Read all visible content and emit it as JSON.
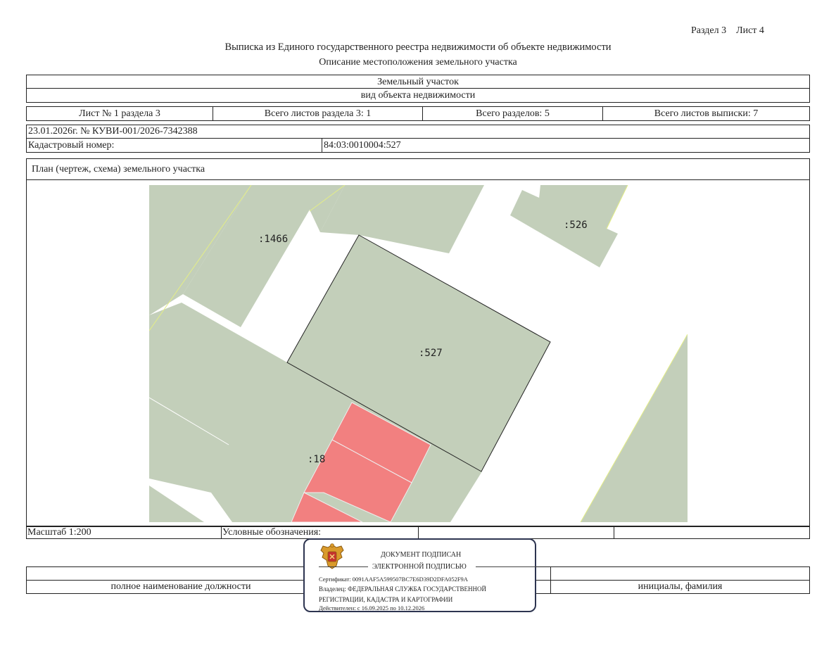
{
  "header": {
    "section_sheet": "Раздел 3    Лист 4",
    "title": "Выписка из Единого государственного реестра недвижимости об объекте недвижимости",
    "subtitle": "Описание местоположения земельного участка"
  },
  "object": {
    "type": "Земельный участок",
    "type_caption": "вид объекта недвижимости"
  },
  "sheet_info": {
    "sheet": "Лист № 1 раздела 3",
    "total_sheets_section": "Всего листов раздела 3: 1",
    "total_sections": "Всего разделов: 5",
    "total_sheets": "Всего листов выписки: 7"
  },
  "doc_number": "23.01.2026г. № КУВИ-001/2026-7342388",
  "cadastral": {
    "label": "Кадастровый номер:",
    "value": "84:03:0010004:527"
  },
  "plan": {
    "title": "План (чертеж, схема) земельного участка",
    "labels": {
      "p1466": ":1466",
      "p526": ":526",
      "p527": ":527",
      "p18": ":18"
    },
    "colors": {
      "parcel": "#c3cfba",
      "building": "#f28080",
      "border_line": "#e4ee86"
    }
  },
  "footer": {
    "scale": "Масштаб 1:200",
    "legend": "Условные обозначения:",
    "position_caption": "полное наименование должности",
    "name_caption": "инициалы, фамилия"
  },
  "signature": {
    "line1": "ДОКУМЕНТ ПОДПИСАН",
    "line2": "ЭЛЕКТРОННОЙ ПОДПИСЬЮ",
    "certificate": "Сертификат: 0091AAF5A599507BC7E6D39D2DFA052F9A",
    "owner": "Владелец: ФЕДЕРАЛЬНАЯ СЛУЖБА ГОСУДАРСТВЕННОЙ",
    "owner2": "РЕГИСТРАЦИИ, КАДАСТРА И КАРТОГРАФИИ",
    "valid": "Действителен: с 16.09.2025 по 10.12.2026",
    "emblem": "emblem-icon"
  }
}
